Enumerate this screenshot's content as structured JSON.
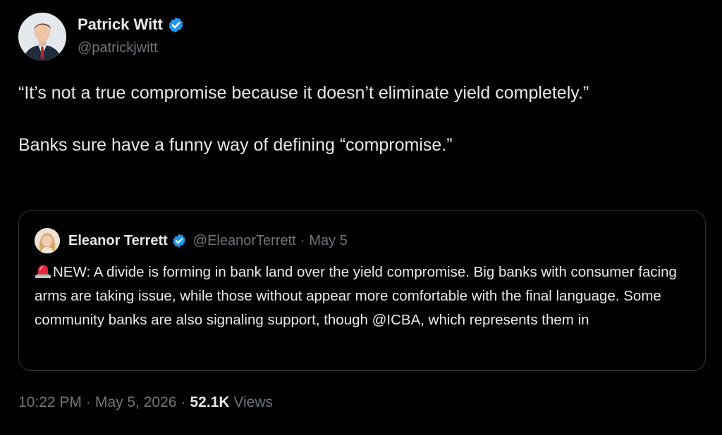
{
  "author": {
    "name": "Patrick Witt",
    "handle": "@patrickjwitt",
    "verified": true,
    "avatar_icon": "profile-photo-man-in-suit"
  },
  "tweet": {
    "paragraphs": [
      "“It’s not a true compromise because it doesn’t eliminate yield completely.”",
      "Banks sure have a funny way of defining “compromise.”"
    ]
  },
  "quote": {
    "author_name": "Eleanor Terrett",
    "handle": "@EleanorTerrett",
    "separator": "·",
    "date": "May 5",
    "verified": true,
    "avatar_icon": "profile-photo-woman",
    "lead_icon": "rotating-light-siren-emoji",
    "text": "NEW: A divide is forming in bank land over the yield compromise. Big banks with consumer facing arms are taking issue, while those without appear more comfortable with the final language. Some community banks are also signaling support, though @ICBA, which represents them in"
  },
  "meta": {
    "time": "10:22 PM",
    "separator": "·",
    "date": "May 5, 2026",
    "views_count": "52.1K",
    "views_label": "Views"
  },
  "colors": {
    "background": "#000000",
    "text_primary": "#e7e9ea",
    "text_secondary": "#71767b",
    "border": "#2f3336",
    "verified_blue": "#1d9bf0"
  }
}
